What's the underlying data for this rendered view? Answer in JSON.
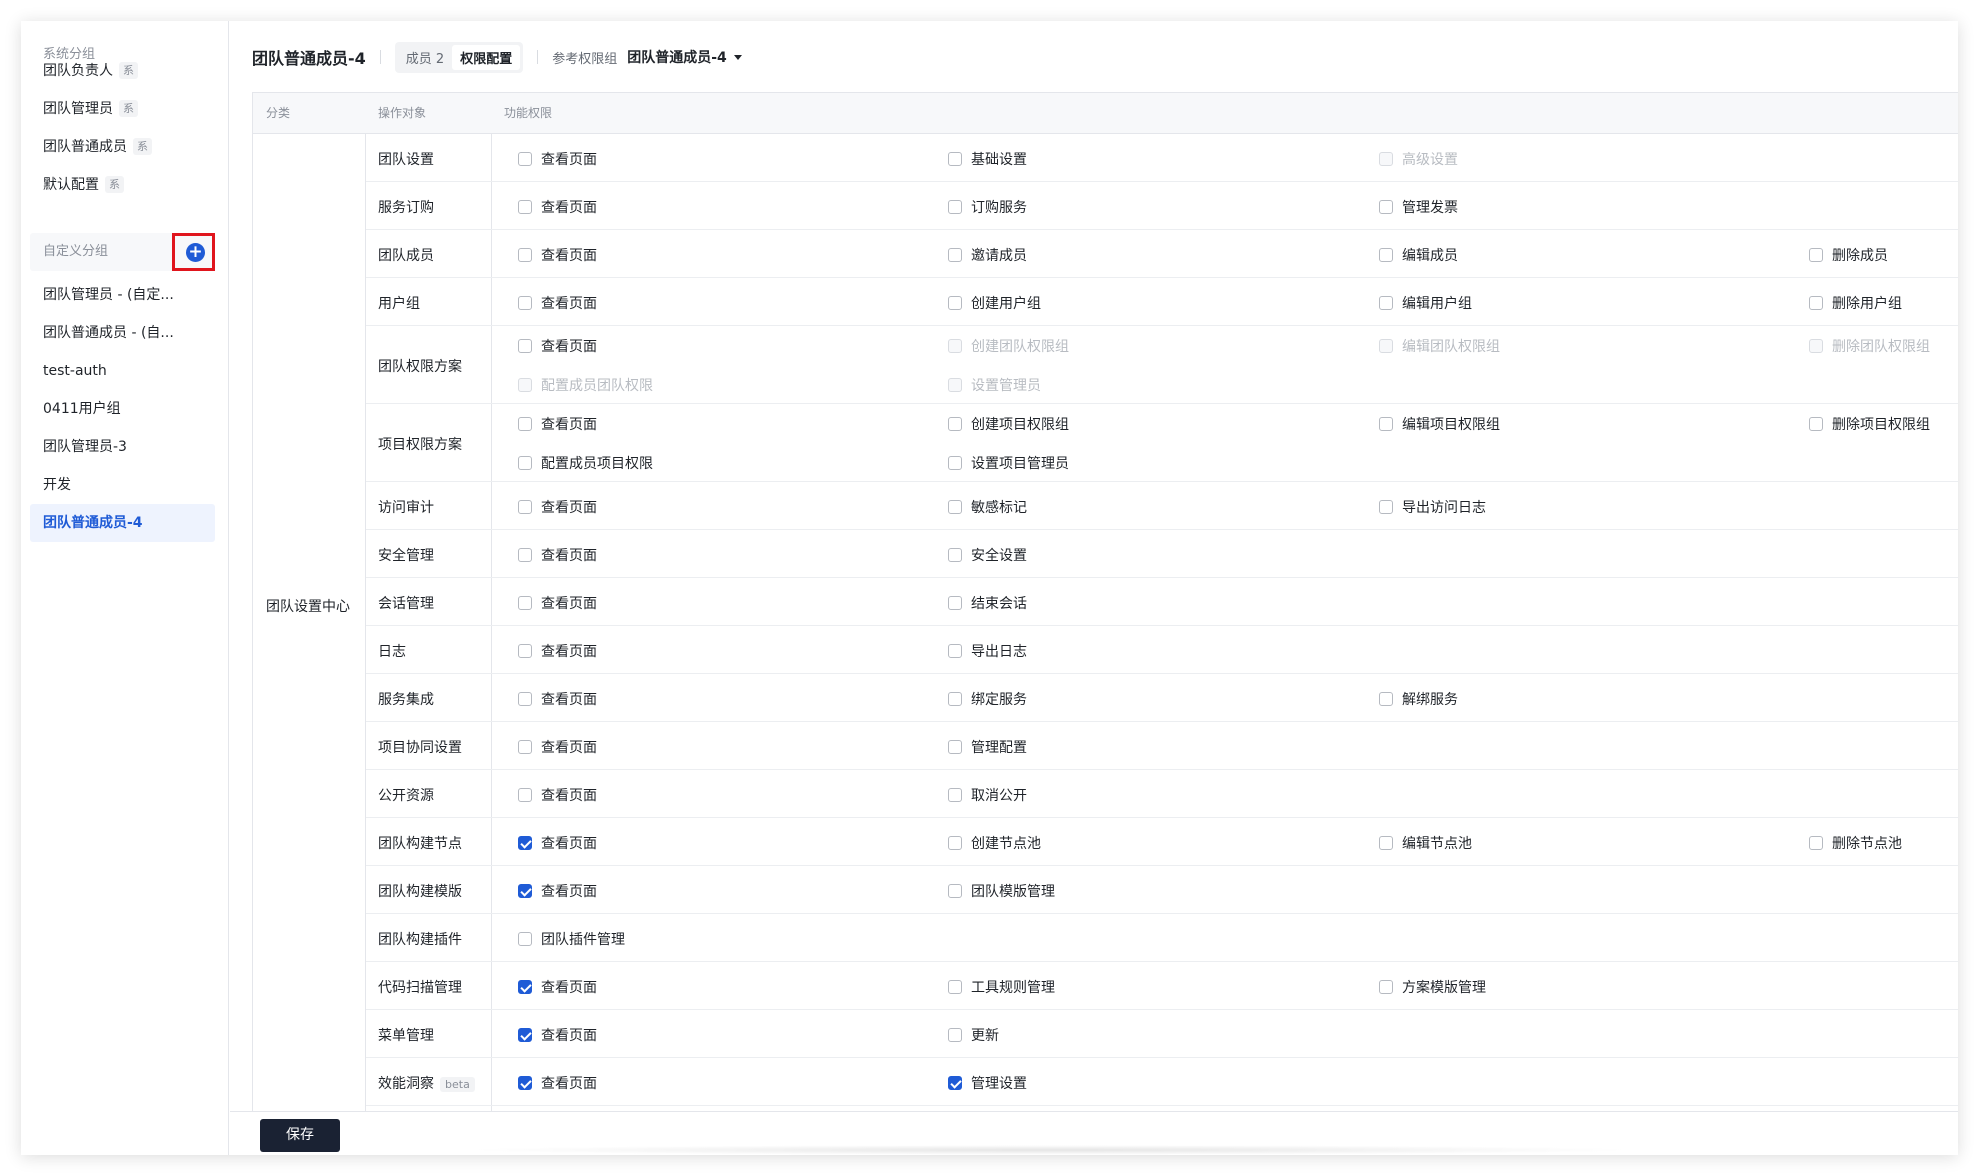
{
  "sidebar": {
    "system_group_label": "系统分组",
    "system_items": [
      {
        "label": "团队负责人",
        "badge": "系"
      },
      {
        "label": "团队管理员",
        "badge": "系"
      },
      {
        "label": "团队普通成员",
        "badge": "系"
      },
      {
        "label": "默认配置",
        "badge": "系"
      }
    ],
    "custom_group_label": "自定义分组",
    "add_icon": "plus-circle-icon",
    "custom_items": [
      {
        "label": "团队管理员 - (自定..."
      },
      {
        "label": "团队普通成员 - (自..."
      },
      {
        "label": "test-auth"
      },
      {
        "label": "0411用户组"
      },
      {
        "label": "团队管理员-3"
      },
      {
        "label": "开发"
      },
      {
        "label": "团队普通成员-4",
        "active": true
      }
    ]
  },
  "header": {
    "title": "团队普通成员-4",
    "tab_members": "成员 2",
    "tab_permissions": "权限配置",
    "ref_label": "参考权限组",
    "ref_value": "团队普通成员-4"
  },
  "table": {
    "col_category": "分类",
    "col_object": "操作对象",
    "col_permission": "功能权限",
    "category": "团队设置中心",
    "rows": [
      {
        "object": "团队设置",
        "lines": [
          [
            {
              "label": "查看页面",
              "checked": false,
              "disabled": false
            },
            {
              "label": "基础设置",
              "checked": false,
              "disabled": false
            },
            {
              "label": "高级设置",
              "checked": false,
              "disabled": true
            }
          ]
        ]
      },
      {
        "object": "服务订购",
        "lines": [
          [
            {
              "label": "查看页面",
              "checked": false,
              "disabled": false
            },
            {
              "label": "订购服务",
              "checked": false,
              "disabled": false
            },
            {
              "label": "管理发票",
              "checked": false,
              "disabled": false
            }
          ]
        ]
      },
      {
        "object": "团队成员",
        "lines": [
          [
            {
              "label": "查看页面",
              "checked": false,
              "disabled": false
            },
            {
              "label": "邀请成员",
              "checked": false,
              "disabled": false
            },
            {
              "label": "编辑成员",
              "checked": false,
              "disabled": false
            },
            {
              "label": "删除成员",
              "checked": false,
              "disabled": false
            }
          ]
        ]
      },
      {
        "object": "用户组",
        "lines": [
          [
            {
              "label": "查看页面",
              "checked": false,
              "disabled": false
            },
            {
              "label": "创建用户组",
              "checked": false,
              "disabled": false
            },
            {
              "label": "编辑用户组",
              "checked": false,
              "disabled": false
            },
            {
              "label": "删除用户组",
              "checked": false,
              "disabled": false
            }
          ]
        ]
      },
      {
        "object": "团队权限方案",
        "lines": [
          [
            {
              "label": "查看页面",
              "checked": false,
              "disabled": false
            },
            {
              "label": "创建团队权限组",
              "checked": false,
              "disabled": true
            },
            {
              "label": "编辑团队权限组",
              "checked": false,
              "disabled": true
            },
            {
              "label": "删除团队权限组",
              "checked": false,
              "disabled": true
            }
          ],
          [
            {
              "label": "配置成员团队权限",
              "checked": false,
              "disabled": true
            },
            {
              "label": "设置管理员",
              "checked": false,
              "disabled": true
            }
          ]
        ]
      },
      {
        "object": "项目权限方案",
        "lines": [
          [
            {
              "label": "查看页面",
              "checked": false,
              "disabled": false
            },
            {
              "label": "创建项目权限组",
              "checked": false,
              "disabled": false
            },
            {
              "label": "编辑项目权限组",
              "checked": false,
              "disabled": false
            },
            {
              "label": "删除项目权限组",
              "checked": false,
              "disabled": false
            }
          ],
          [
            {
              "label": "配置成员项目权限",
              "checked": false,
              "disabled": false
            },
            {
              "label": "设置项目管理员",
              "checked": false,
              "disabled": false
            }
          ]
        ]
      },
      {
        "object": "访问审计",
        "lines": [
          [
            {
              "label": "查看页面",
              "checked": false,
              "disabled": false
            },
            {
              "label": "敏感标记",
              "checked": false,
              "disabled": false
            },
            {
              "label": "导出访问日志",
              "checked": false,
              "disabled": false
            }
          ]
        ]
      },
      {
        "object": "安全管理",
        "lines": [
          [
            {
              "label": "查看页面",
              "checked": false,
              "disabled": false
            },
            {
              "label": "安全设置",
              "checked": false,
              "disabled": false
            }
          ]
        ]
      },
      {
        "object": "会话管理",
        "lines": [
          [
            {
              "label": "查看页面",
              "checked": false,
              "disabled": false
            },
            {
              "label": "结束会话",
              "checked": false,
              "disabled": false
            }
          ]
        ]
      },
      {
        "object": "日志",
        "lines": [
          [
            {
              "label": "查看页面",
              "checked": false,
              "disabled": false
            },
            {
              "label": "导出日志",
              "checked": false,
              "disabled": false
            }
          ]
        ]
      },
      {
        "object": "服务集成",
        "lines": [
          [
            {
              "label": "查看页面",
              "checked": false,
              "disabled": false
            },
            {
              "label": "绑定服务",
              "checked": false,
              "disabled": false
            },
            {
              "label": "解绑服务",
              "checked": false,
              "disabled": false
            }
          ]
        ]
      },
      {
        "object": "项目协同设置",
        "lines": [
          [
            {
              "label": "查看页面",
              "checked": false,
              "disabled": false
            },
            {
              "label": "管理配置",
              "checked": false,
              "disabled": false
            }
          ]
        ]
      },
      {
        "object": "公开资源",
        "lines": [
          [
            {
              "label": "查看页面",
              "checked": false,
              "disabled": false
            },
            {
              "label": "取消公开",
              "checked": false,
              "disabled": false
            }
          ]
        ]
      },
      {
        "object": "团队构建节点",
        "lines": [
          [
            {
              "label": "查看页面",
              "checked": true,
              "disabled": false
            },
            {
              "label": "创建节点池",
              "checked": false,
              "disabled": false
            },
            {
              "label": "编辑节点池",
              "checked": false,
              "disabled": false
            },
            {
              "label": "删除节点池",
              "checked": false,
              "disabled": false
            }
          ]
        ]
      },
      {
        "object": "团队构建模版",
        "lines": [
          [
            {
              "label": "查看页面",
              "checked": true,
              "disabled": false
            },
            {
              "label": "团队模版管理",
              "checked": false,
              "disabled": false
            }
          ]
        ]
      },
      {
        "object": "团队构建插件",
        "lines": [
          [
            {
              "label": "团队插件管理",
              "checked": false,
              "disabled": false
            }
          ]
        ]
      },
      {
        "object": "代码扫描管理",
        "lines": [
          [
            {
              "label": "查看页面",
              "checked": true,
              "disabled": false
            },
            {
              "label": "工具规则管理",
              "checked": false,
              "disabled": false
            },
            {
              "label": "方案模版管理",
              "checked": false,
              "disabled": false
            }
          ]
        ]
      },
      {
        "object": "菜单管理",
        "lines": [
          [
            {
              "label": "查看页面",
              "checked": true,
              "disabled": false
            },
            {
              "label": "更新",
              "checked": false,
              "disabled": false
            }
          ]
        ]
      },
      {
        "object": "效能洞察",
        "badge": "beta",
        "lines": [
          [
            {
              "label": "查看页面",
              "checked": true,
              "disabled": false
            },
            {
              "label": "管理设置",
              "checked": true,
              "disabled": false
            }
          ]
        ]
      }
    ]
  },
  "footer": {
    "save_label": "保存"
  },
  "colors": {
    "accent": "#1f5bd6",
    "highlight_box": "#e0151d",
    "save_button": "#1a2233"
  }
}
